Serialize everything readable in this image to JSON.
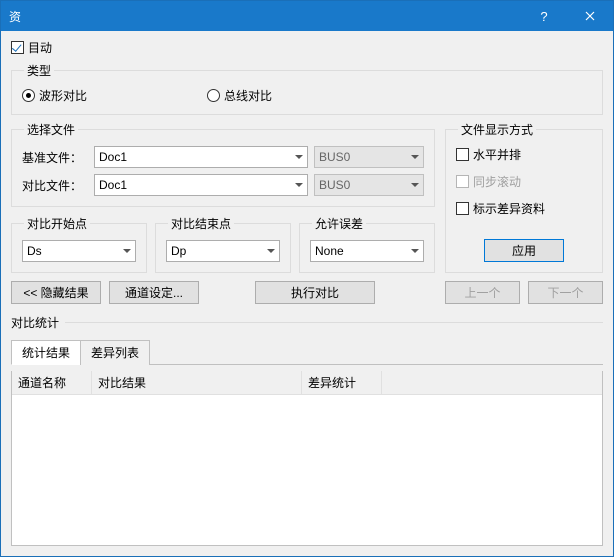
{
  "window": {
    "title": "资"
  },
  "auto_checkbox": {
    "label": "目动",
    "checked": true
  },
  "type_group": {
    "legend": "类型",
    "options": [
      {
        "label": "波形对比",
        "selected": true
      },
      {
        "label": "总线对比",
        "selected": false
      }
    ]
  },
  "file_group": {
    "legend": "选择文件",
    "base_label": "基准文件：",
    "base_value": "Doc1",
    "base_bus": "BUS0",
    "cmp_label": "对比文件：",
    "cmp_value": "Doc1",
    "cmp_bus": "BUS0"
  },
  "range": {
    "start_legend": "对比开始点",
    "start_value": "Ds",
    "end_legend": "对比结束点",
    "end_value": "Dp",
    "tol_legend": "允许误差",
    "tol_value": "None"
  },
  "display_group": {
    "legend": "文件显示方式",
    "side_by_side": {
      "label": "水平并排",
      "checked": false
    },
    "sync_scroll": {
      "label": "同步滚动",
      "checked": false,
      "disabled": true
    },
    "mark_diff": {
      "label": "标示差异资料",
      "checked": false
    },
    "apply_label": "应用"
  },
  "actions": {
    "hide_result": "<< 隐藏结果",
    "channel_settings": "通道设定...",
    "run": "执行对比",
    "prev": "上一个",
    "next": "下一个"
  },
  "stats_legend": "对比统计",
  "tabs": [
    {
      "label": "统计结果",
      "active": true
    },
    {
      "label": "差异列表",
      "active": false
    }
  ],
  "columns": [
    "通道名称",
    "对比结果",
    "差异统计"
  ]
}
